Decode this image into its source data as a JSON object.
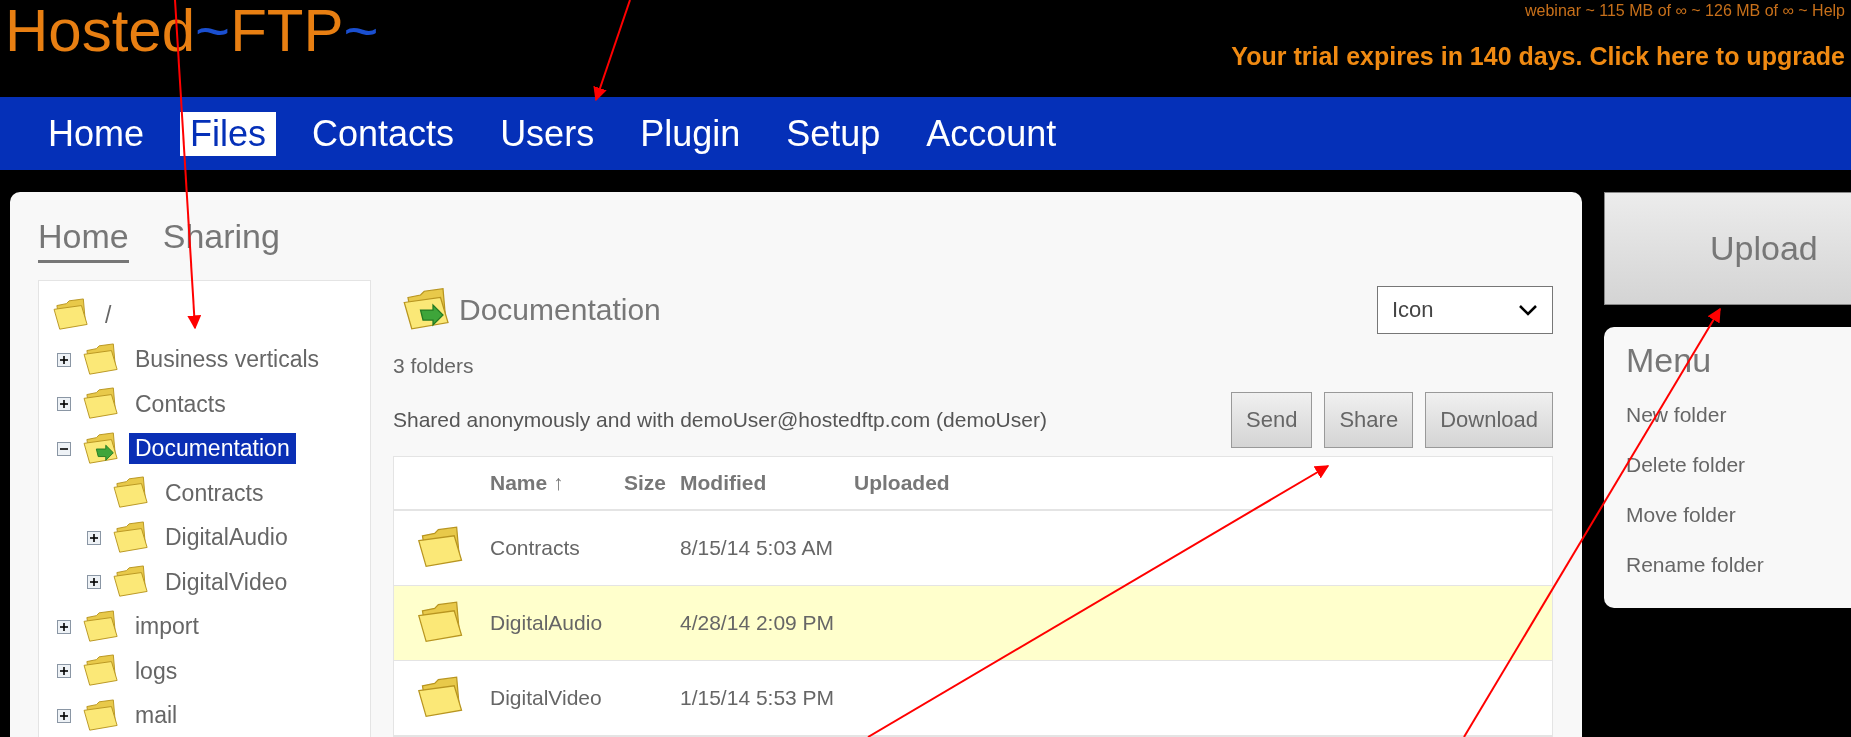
{
  "header": {
    "logo": [
      {
        "text": "Hosted",
        "accent": false
      },
      {
        "text": "~",
        "accent": true
      },
      {
        "text": "FTP",
        "accent": false
      },
      {
        "text": "~",
        "accent": true
      }
    ],
    "usage": "webinar  ~  115 MB of ∞  ~  126 MB of ∞  ~  Help",
    "trial": "Your trial expires in 140 days. Click here to upgrade"
  },
  "nav": [
    {
      "label": "Home",
      "selected": false
    },
    {
      "label": "Files",
      "selected": true
    },
    {
      "label": "Contacts",
      "selected": false
    },
    {
      "label": "Users",
      "selected": false
    },
    {
      "label": "Plugin",
      "selected": false
    },
    {
      "label": "Setup",
      "selected": false
    },
    {
      "label": "Account",
      "selected": false
    }
  ],
  "tabs": [
    {
      "label": "Home",
      "selected": true
    },
    {
      "label": "Sharing",
      "selected": false
    }
  ],
  "tree": [
    {
      "label": "/",
      "selected": false,
      "shared": false,
      "children": [
        {
          "label": "Business verticals",
          "expandable": true,
          "expanded": false,
          "selected": false,
          "shared": false
        },
        {
          "label": "Contacts",
          "expandable": true,
          "expanded": false,
          "selected": false,
          "shared": false
        },
        {
          "label": "Documentation",
          "expandable": true,
          "expanded": true,
          "selected": true,
          "shared": true,
          "children": [
            {
              "label": "Contracts",
              "expandable": false,
              "selected": false,
              "shared": false
            },
            {
              "label": "DigitalAudio",
              "expandable": true,
              "expanded": false,
              "selected": false,
              "shared": false
            },
            {
              "label": "DigitalVideo",
              "expandable": true,
              "expanded": false,
              "selected": false,
              "shared": false
            }
          ]
        },
        {
          "label": "import",
          "expandable": true,
          "expanded": false,
          "selected": false,
          "shared": false
        },
        {
          "label": "logs",
          "expandable": true,
          "expanded": false,
          "selected": false,
          "shared": false
        },
        {
          "label": "mail",
          "expandable": true,
          "expanded": false,
          "selected": false,
          "shared": false
        }
      ]
    }
  ],
  "folder": {
    "title": "Documentation",
    "shared": true,
    "count": "3 folders",
    "view_select": {
      "value": "Icon"
    },
    "sharing_note": "Shared anonymously and with demoUser@hostedftp.com (demoUser)",
    "buttons": [
      "Send",
      "Share",
      "Download"
    ]
  },
  "table": {
    "columns": [
      "Name ↑",
      "Size",
      "Modified",
      "Uploaded"
    ],
    "rows": [
      {
        "name": "Contracts",
        "modified": "8/15/14 5:03 AM",
        "selected": false
      },
      {
        "name": "DigitalAudio",
        "modified": "4/28/14 2:09 PM",
        "selected": true
      },
      {
        "name": "DigitalVideo",
        "modified": "1/15/14 5:53 PM",
        "selected": false
      }
    ]
  },
  "upload_button": "Upload",
  "menu": {
    "title": "Menu",
    "items": [
      "New folder",
      "Delete folder",
      "Move folder",
      "Rename folder"
    ]
  }
}
